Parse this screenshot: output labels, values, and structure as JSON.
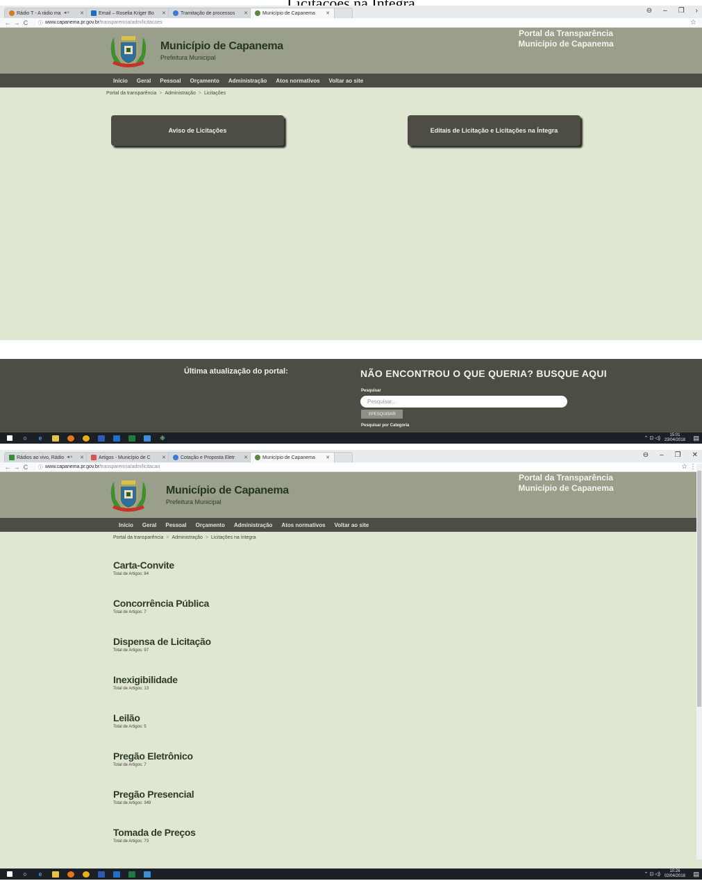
{
  "caption": "Licitações na Íntegra",
  "shot1": {
    "tabs": [
      {
        "label": "Rádio T - A rádio ma",
        "icon_color": "#d97a1a",
        "audio": "◄×"
      },
      {
        "label": "Email – Roselia Kriger Bo",
        "icon_color": "#1a6fc4"
      },
      {
        "label": "Tramitação de processos",
        "icon_color": "#3a7bd5"
      },
      {
        "label": "Município de Capanema",
        "icon_color": "#5a8a3a"
      }
    ],
    "url_domain": "www.capanema.pr.gov.br",
    "url_path": "/transparencia/adm/licitacoes",
    "site_name": "Município de Capanema",
    "site_sub": "Prefeitura Municipal",
    "portal_line1": "Portal da Transparência",
    "portal_line2": "Município de Capanema",
    "nav": [
      "Início",
      "Geral",
      "Pessoal",
      "Orçamento",
      "Administração",
      "Atos normativos",
      "Voltar ao site"
    ],
    "breadcrumb": [
      "Portal da transparência",
      "Administração",
      "Licitações"
    ],
    "btn_aviso": "Aviso de Licitações",
    "btn_editais": "Editais de Licitação e Licitações na Íntegra",
    "footer_updated": "Última atualização do portal:",
    "footer_find": "NÃO ENCONTROU O QUE QUERIA? BUSQUE AQUI",
    "label_pesquisar": "Pesquisar",
    "search_placeholder": "Pesquisar...",
    "search_button": "PESQUISAR",
    "label_categoria": "Pesquisar por Categoria",
    "clock_time": "15:01",
    "clock_date": "23/04/2018"
  },
  "shot2": {
    "tabs": [
      {
        "label": "Rádios ao vivo, Rádio",
        "icon_color": "#2f8f3a",
        "audio": "◄×"
      },
      {
        "label": "Artigos - Município de C",
        "icon_color": "#d9534f"
      },
      {
        "label": "Cotação e Proposta Eletr",
        "icon_color": "#3a7bd5"
      },
      {
        "label": "Município de Capanema",
        "icon_color": "#5a8a3a"
      }
    ],
    "url_domain": "www.capanema.pr.gov.br",
    "url_path": "/transparencia/adm/licitacao",
    "breadcrumb": [
      "Portal da transparência",
      "Administração",
      "Licitações na íntegra"
    ],
    "categories": [
      {
        "title": "Carta-Convite",
        "count": "Total de Artigos: 84"
      },
      {
        "title": "Concorrência Pública",
        "count": "Total de Artigos: 7"
      },
      {
        "title": "Dispensa de Licitação",
        "count": "Total de Artigos: 97"
      },
      {
        "title": "Inexigibilidade",
        "count": "Total de Artigos: 13"
      },
      {
        "title": "Leilão",
        "count": "Total de Artigos: 5"
      },
      {
        "title": "Pregão Eletrônico",
        "count": "Total de Artigos: 7"
      },
      {
        "title": "Pregão Presencial",
        "count": "Total de Artigos: 349"
      },
      {
        "title": "Tomada de Preços",
        "count": "Total de Artigos: 73"
      }
    ],
    "clock_time": "10:26",
    "clock_date": "02/04/2018"
  },
  "colors": {
    "header": "#9a9f8c",
    "nav": "#4d4c45",
    "body": "#dfe7d2",
    "title_text": "#24361c"
  },
  "icons": [
    "info-icon",
    "star-icon",
    "search-icon",
    "windows-icon",
    "cortana-icon",
    "edge-icon",
    "explorer-icon",
    "firefox-icon",
    "chrome-icon",
    "word-icon",
    "outlook-icon",
    "excel-icon",
    "notification-icon"
  ]
}
